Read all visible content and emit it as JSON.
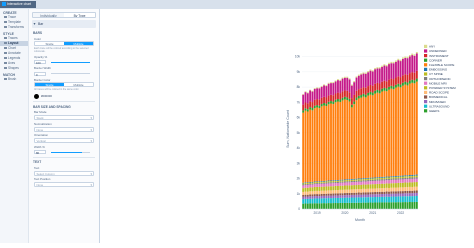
{
  "app": {
    "title": "Interactive chart"
  },
  "nav": {
    "sections": [
      {
        "label": "CREATE",
        "items": [
          {
            "label": "Trace",
            "icon": "trace-icon"
          },
          {
            "label": "Template",
            "icon": "template-icon"
          },
          {
            "label": "Transforms",
            "icon": "transforms-icon"
          }
        ]
      },
      {
        "label": "STYLE",
        "items": [
          {
            "label": "Traces",
            "icon": "traces-icon"
          },
          {
            "label": "Layout",
            "icon": "layout-icon",
            "active": true
          },
          {
            "label": "Chart",
            "icon": "chart-icon"
          },
          {
            "label": "Annotate",
            "icon": "annotate-icon"
          },
          {
            "label": "Legends",
            "icon": "legends-icon"
          },
          {
            "label": "Axes",
            "icon": "axes-icon"
          },
          {
            "label": "Shapes",
            "icon": "shapes-icon"
          }
        ]
      },
      {
        "label": "MATCH",
        "items": [
          {
            "label": "Brush",
            "icon": "brush-icon"
          }
        ]
      }
    ]
  },
  "panel": {
    "tabs": [
      "Individually",
      "By Type"
    ],
    "active_tab": "By Type",
    "trace_header": "Bar",
    "bars_section": "BARS",
    "color_label": "Color",
    "color_options": [
      "Single",
      "Multiple"
    ],
    "color_selected": "Multiple",
    "color_note": "Each trace will be colored according to the selected colorscale.",
    "opacity_label": "Opacity %",
    "opacity_value": "100",
    "opacity_fill": 1.0,
    "border_width_label": "Border Width",
    "border_width_value": "0",
    "border_width_fill": 0.0,
    "border_color_label": "Border Color",
    "border_color_options": [
      "Single",
      "Multiple"
    ],
    "border_color_selected": "Single",
    "border_color_note": "All traces will be colored in the same color.",
    "border_color_hex": "#000000",
    "size_section": "BAR SIZE AND SPACING",
    "bar_mode_label": "Bar Mode",
    "bar_mode_value": "Stack",
    "normalization_label": "Normalization",
    "normalization_value": "None",
    "orientation_label": "Orientation",
    "orientation_value": "Vertical",
    "width_label": "Width %",
    "width_value": "80",
    "width_fill": 0.8,
    "text_section": "TEXT",
    "text_label": "Text",
    "text_value": "Select Column",
    "text_position_label": "Text Position",
    "text_position_value": "None"
  },
  "colors": {
    "accent": "#119dff"
  },
  "chart_data": {
    "type": "bar",
    "stacked": true,
    "xlabel": "Month",
    "ylabel": "Sum, Nationwide Count",
    "x_ticks": [
      "2019",
      "2020",
      "2021",
      "2022"
    ],
    "y_ticks": [
      "0",
      "1k",
      "2k",
      "3k",
      "4k",
      "5k",
      "6k",
      "7k",
      "8k",
      "9k",
      "10k"
    ],
    "ylim": [
      0,
      10500
    ],
    "legend_position": "right",
    "months": [
      "2018-07",
      "2018-08",
      "2018-09",
      "2018-10",
      "2018-11",
      "2018-12",
      "2019-01",
      "2019-02",
      "2019-03",
      "2019-04",
      "2019-05",
      "2019-06",
      "2019-07",
      "2019-08",
      "2019-09",
      "2019-10",
      "2019-11",
      "2019-12",
      "2020-01",
      "2020-02",
      "2020-03",
      "2020-04",
      "2020-05",
      "2020-06",
      "2020-07",
      "2020-08",
      "2020-09",
      "2020-10",
      "2020-11",
      "2020-12",
      "2021-01",
      "2021-02",
      "2021-03",
      "2021-04",
      "2021-05",
      "2021-06",
      "2021-07",
      "2021-08",
      "2021-09",
      "2021-10",
      "2021-11",
      "2021-12",
      "2022-01",
      "2022-02",
      "2022-03",
      "2022-04",
      "2022-05",
      "2022-06",
      "2022-07",
      "2022-08"
    ],
    "series": [
      {
        "name": "GEEKS",
        "color": "#2ca02c",
        "values": [
          350,
          360,
          355,
          370,
          365,
          380,
          375,
          370,
          380,
          385,
          380,
          390,
          385,
          390,
          395,
          390,
          400,
          395,
          400,
          405,
          400,
          410,
          405,
          410,
          415,
          410,
          420,
          415,
          420,
          425,
          420,
          430,
          425,
          430,
          435,
          430,
          440,
          435,
          440,
          445,
          440,
          450,
          445,
          450,
          455,
          450,
          460,
          455,
          460,
          465
        ]
      },
      {
        "name": "ULTRASOUND",
        "color": "#17becf",
        "values": [
          300,
          305,
          310,
          308,
          312,
          315,
          318,
          320,
          318,
          322,
          325,
          328,
          326,
          330,
          332,
          335,
          333,
          338,
          340,
          342,
          340,
          344,
          346,
          348,
          350,
          348,
          352,
          355,
          353,
          357,
          360,
          358,
          362,
          365,
          363,
          367,
          370,
          368,
          372,
          375,
          373,
          377,
          380,
          378,
          382,
          385,
          383,
          387,
          390,
          392
        ]
      },
      {
        "name": "MRI-BASED",
        "color": "#9467bd",
        "values": [
          150,
          152,
          151,
          155,
          154,
          156,
          158,
          157,
          160,
          159,
          162,
          161,
          164,
          163,
          166,
          165,
          168,
          167,
          170,
          169,
          172,
          171,
          174,
          173,
          176,
          175,
          178,
          177,
          180,
          179,
          182,
          181,
          184,
          183,
          186,
          185,
          188,
          187,
          190,
          189,
          192,
          191,
          194,
          193,
          196,
          195,
          198,
          197,
          200,
          199
        ]
      },
      {
        "name": "BIOMEDICAL",
        "color": "#8c564b",
        "values": [
          120,
          122,
          121,
          124,
          123,
          125,
          127,
          126,
          128,
          127,
          130,
          129,
          131,
          130,
          133,
          132,
          134,
          133,
          136,
          135,
          137,
          136,
          139,
          138,
          140,
          139,
          142,
          141,
          143,
          142,
          145,
          144,
          146,
          145,
          148,
          147,
          149,
          148,
          151,
          150,
          152,
          151,
          154,
          153,
          155,
          154,
          157,
          156,
          158,
          157
        ]
      },
      {
        "name": "ROAD SCOPE",
        "color": "#ffbb78",
        "values": [
          200,
          205,
          203,
          208,
          206,
          210,
          212,
          211,
          214,
          213,
          216,
          215,
          218,
          217,
          220,
          219,
          222,
          221,
          224,
          223,
          226,
          225,
          228,
          227,
          230,
          229,
          232,
          231,
          234,
          233,
          236,
          235,
          238,
          237,
          240,
          239,
          242,
          241,
          244,
          243,
          246,
          245,
          248,
          247,
          250,
          249,
          252,
          251,
          254,
          253
        ]
      },
      {
        "name": "POWDER SYSTEM",
        "color": "#bcbd22",
        "values": [
          250,
          255,
          253,
          258,
          256,
          260,
          262,
          261,
          264,
          263,
          266,
          265,
          268,
          267,
          270,
          269,
          272,
          271,
          274,
          273,
          276,
          275,
          278,
          277,
          280,
          279,
          282,
          281,
          284,
          283,
          286,
          285,
          288,
          287,
          290,
          289,
          292,
          291,
          294,
          293,
          296,
          295,
          298,
          297,
          300,
          299,
          302,
          301,
          304,
          303
        ]
      },
      {
        "name": "MOBILE MRI",
        "color": "#e377c2",
        "values": [
          180,
          182,
          181,
          184,
          183,
          186,
          185,
          188,
          187,
          190,
          189,
          192,
          191,
          194,
          193,
          196,
          195,
          198,
          197,
          200,
          199,
          202,
          201,
          204,
          203,
          206,
          205,
          208,
          207,
          210,
          209,
          212,
          211,
          214,
          213,
          216,
          215,
          218,
          217,
          220,
          219,
          222,
          221,
          224,
          223,
          226,
          225,
          228,
          227,
          230
        ]
      },
      {
        "name": "ORTHOPAEDIC",
        "color": "#7f7f7f",
        "values": [
          60,
          61,
          62,
          61,
          63,
          64,
          63,
          65,
          66,
          65,
          67,
          68,
          67,
          69,
          70,
          69,
          71,
          72,
          71,
          73,
          74,
          73,
          75,
          76,
          75,
          77,
          78,
          77,
          79,
          80,
          79,
          81,
          82,
          81,
          83,
          84,
          83,
          85,
          86,
          85,
          87,
          88,
          87,
          89,
          90,
          89,
          91,
          92,
          91,
          93
        ]
      },
      {
        "name": "CT SPINE",
        "color": "#bcbd22",
        "values": [
          70,
          71,
          72,
          71,
          73,
          74,
          73,
          75,
          76,
          75,
          77,
          78,
          77,
          79,
          80,
          79,
          81,
          82,
          81,
          83,
          84,
          83,
          85,
          86,
          85,
          87,
          88,
          87,
          89,
          90,
          89,
          91,
          92,
          91,
          93,
          94,
          93,
          95,
          96,
          95,
          97,
          98,
          97,
          99,
          100,
          99,
          101,
          102,
          101,
          103
        ]
      },
      {
        "name": "EMBOSSING",
        "color": "#1f77b4",
        "values": [
          40,
          41,
          40,
          42,
          41,
          43,
          42,
          44,
          43,
          45,
          44,
          46,
          45,
          47,
          46,
          48,
          47,
          49,
          48,
          50,
          49,
          51,
          50,
          52,
          51,
          53,
          52,
          54,
          53,
          55,
          54,
          56,
          55,
          57,
          56,
          58,
          57,
          59,
          58,
          60,
          59,
          61,
          60,
          62,
          61,
          63,
          62,
          64,
          63,
          65
        ]
      },
      {
        "name": "FLEXIBLE SCOPE",
        "color": "#ff7f0e",
        "values": [
          4600,
          4700,
          4650,
          4750,
          4700,
          4800,
          4850,
          4800,
          4900,
          4950,
          4900,
          5000,
          5050,
          5000,
          5100,
          5150,
          5100,
          5200,
          5250,
          5200,
          5100,
          4700,
          4900,
          5150,
          5250,
          5300,
          5350,
          5300,
          5400,
          5450,
          5400,
          5500,
          5550,
          5500,
          5600,
          5650,
          5600,
          5700,
          5750,
          5700,
          5800,
          5850,
          5800,
          5900,
          5950,
          5900,
          6000,
          6050,
          6000,
          6100
        ]
      },
      {
        "name": "CORNER",
        "color": "#2ca02c",
        "values": [
          150,
          152,
          151,
          154,
          153,
          156,
          155,
          158,
          157,
          160,
          159,
          162,
          161,
          164,
          163,
          166,
          165,
          168,
          167,
          170,
          169,
          172,
          171,
          174,
          173,
          176,
          175,
          178,
          177,
          180,
          179,
          182,
          181,
          184,
          183,
          186,
          185,
          188,
          187,
          190,
          189,
          192,
          191,
          194,
          193,
          196,
          195,
          198,
          197,
          200
        ]
      },
      {
        "name": "INSTRUMENT",
        "color": "#d62728",
        "values": [
          380,
          385,
          383,
          390,
          388,
          395,
          393,
          400,
          398,
          405,
          403,
          410,
          408,
          415,
          413,
          420,
          418,
          425,
          423,
          430,
          428,
          435,
          433,
          440,
          438,
          445,
          443,
          450,
          448,
          455,
          453,
          460,
          458,
          465,
          463,
          470,
          468,
          475,
          473,
          480,
          478,
          485,
          483,
          490,
          488,
          495,
          493,
          500,
          498,
          505
        ]
      },
      {
        "name": "UNDEFINED",
        "color": "#c51b8a",
        "values": [
          650,
          680,
          670,
          700,
          690,
          720,
          710,
          740,
          730,
          760,
          750,
          780,
          770,
          800,
          790,
          820,
          810,
          840,
          830,
          860,
          850,
          820,
          840,
          870,
          880,
          900,
          890,
          920,
          910,
          940,
          930,
          960,
          950,
          980,
          970,
          1000,
          990,
          1020,
          1010,
          1040,
          1030,
          1060,
          1050,
          1080,
          1070,
          1100,
          1090,
          1120,
          1110,
          1140
        ]
      },
      {
        "name": "ANY",
        "color": "#dbdb8d",
        "values": [
          50,
          52,
          51,
          54,
          53,
          56,
          55,
          58,
          57,
          60,
          59,
          62,
          61,
          64,
          63,
          66,
          65,
          68,
          67,
          70,
          69,
          72,
          71,
          74,
          73,
          76,
          75,
          78,
          77,
          80,
          79,
          82,
          81,
          84,
          83,
          86,
          85,
          88,
          87,
          90,
          89,
          92,
          91,
          94,
          93,
          96,
          95,
          98,
          97,
          100
        ]
      }
    ]
  }
}
